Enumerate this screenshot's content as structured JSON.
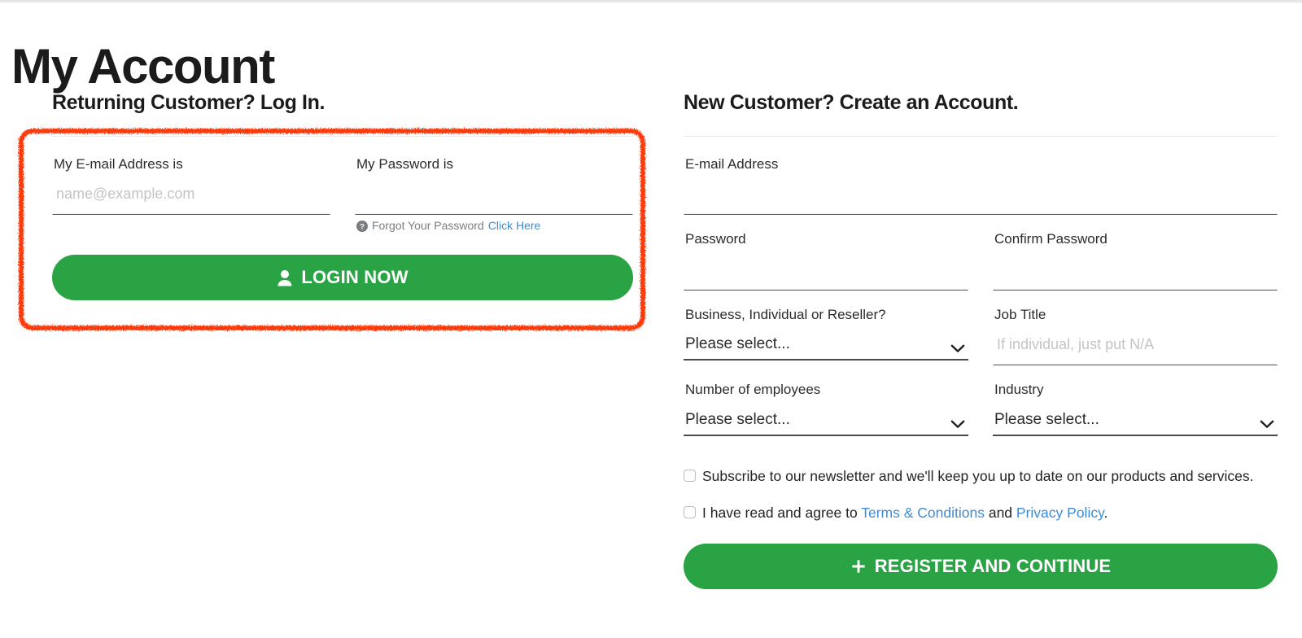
{
  "page": {
    "title": "My Account",
    "accent_green": "#2aa345",
    "link_blue": "#3d8bd6",
    "annotation_color": "#fc3a10"
  },
  "login": {
    "heading": "Returning Customer? Log In.",
    "email": {
      "label": "My E-mail Address is",
      "value": "",
      "placeholder": "name@example.com"
    },
    "password": {
      "label": "My Password is",
      "value": "",
      "placeholder": ""
    },
    "forgot": {
      "icon": "question-circle-icon",
      "text": "Forgot Your Password",
      "link_text": "Click Here"
    },
    "submit": {
      "icon": "user-icon",
      "label": "LOGIN NOW"
    }
  },
  "register": {
    "heading": "New Customer? Create an Account.",
    "email": {
      "label": "E-mail Address",
      "value": "",
      "placeholder": ""
    },
    "password": {
      "label": "Password",
      "value": "",
      "placeholder": ""
    },
    "confirm_password": {
      "label": "Confirm Password",
      "value": "",
      "placeholder": ""
    },
    "account_type": {
      "label": "Business, Individual or Reseller?",
      "selected": "Please select..."
    },
    "job_title": {
      "label": "Job Title",
      "value": "",
      "placeholder": "If individual, just put N/A"
    },
    "employees": {
      "label": "Number of employees",
      "selected": "Please select..."
    },
    "industry": {
      "label": "Industry",
      "selected": "Please select..."
    },
    "newsletter": {
      "text": "Subscribe to our newsletter and we'll keep you up to date on our products and services.",
      "checked": false
    },
    "terms": {
      "prefix": "I have read and agree to ",
      "terms_link": "Terms & Conditions",
      "middle": " and ",
      "privacy_link": "Privacy Policy",
      "suffix": ".",
      "checked": false
    },
    "submit": {
      "icon": "plus-icon",
      "label": "REGISTER AND CONTINUE"
    }
  }
}
